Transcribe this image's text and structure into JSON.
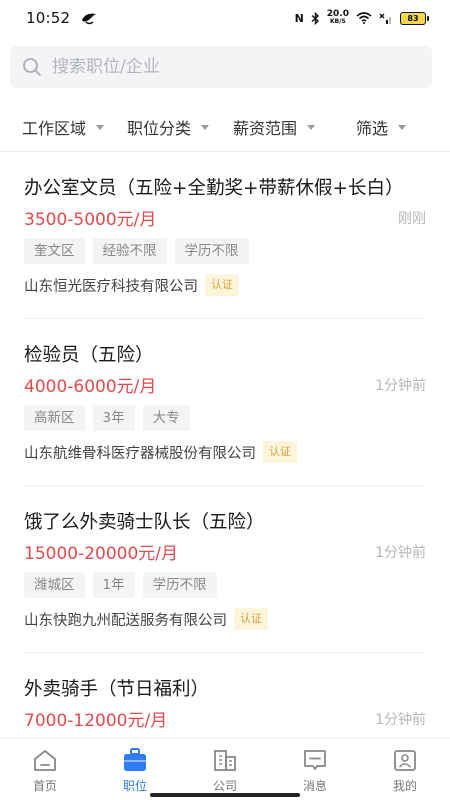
{
  "status_bar": {
    "time": "10:52",
    "net_speed_value": "20.0",
    "net_speed_unit": "KB/S",
    "battery": "83"
  },
  "search": {
    "placeholder": "搜索职位/企业"
  },
  "filters": [
    {
      "label": "工作区域"
    },
    {
      "label": "职位分类"
    },
    {
      "label": "薪资范围"
    },
    {
      "label": "筛选"
    }
  ],
  "jobs": [
    {
      "title": "办公室文员（五险+全勤奖+带薪休假+长白）",
      "salary": "3500-5000元/月",
      "time": "刚刚",
      "tags": [
        "奎文区",
        "经验不限",
        "学历不限"
      ],
      "company": "山东恒光医疗科技有限公司",
      "badge": "认证"
    },
    {
      "title": "检验员（五险）",
      "salary": "4000-6000元/月",
      "time": "1分钟前",
      "tags": [
        "高新区",
        "3年",
        "大专"
      ],
      "company": "山东航维骨科医疗器械股份有限公司",
      "badge": "认证"
    },
    {
      "title": "饿了么外卖骑士队长（五险）",
      "salary": "15000-20000元/月",
      "time": "1分钟前",
      "tags": [
        "潍城区",
        "1年",
        "学历不限"
      ],
      "company": "山东快跑九州配送服务有限公司",
      "badge": "认证"
    },
    {
      "title": "外卖骑手（节日福利）",
      "salary": "7000-12000元/月",
      "time": "1分钟前"
    }
  ],
  "bottom_nav": [
    {
      "label": "首页",
      "icon": "home-icon"
    },
    {
      "label": "职位",
      "icon": "briefcase-icon",
      "active": true
    },
    {
      "label": "公司",
      "icon": "building-icon"
    },
    {
      "label": "消息",
      "icon": "message-icon"
    },
    {
      "label": "我的",
      "icon": "profile-icon"
    }
  ],
  "colors": {
    "accent": "#2f7cf6",
    "salary": "#e8494d",
    "badge_text": "#d5a13a",
    "badge_bg": "#fdf4dc"
  }
}
